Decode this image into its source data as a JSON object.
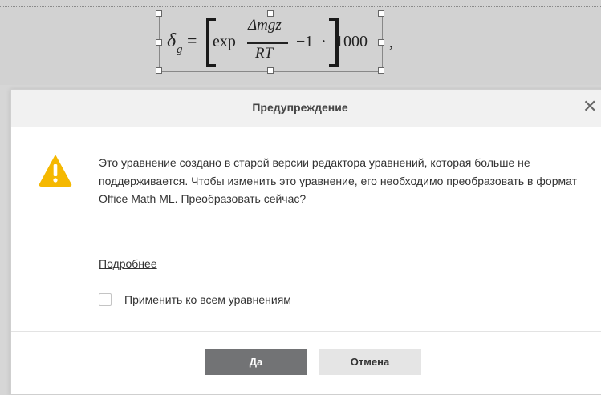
{
  "equation": {
    "delta": "δ",
    "subscript_g": "g",
    "equals": "=",
    "exp": "exp",
    "numerator": "Δmgz",
    "denominator": "RT",
    "minus_one": "−1",
    "dot": "·",
    "thousand": "1000",
    "comma": ","
  },
  "dialog": {
    "title": "Предупреждение",
    "close_glyph": "✕",
    "message": "Это уравнение создано в старой версии редактора уравнений, которая больше не поддерживается. Чтобы изменить это уравнение, его необходимо преобразовать в формат Office Math ML. Преобразовать сейчас?",
    "more_link": "Подробнее",
    "apply_all_label": "Применить ко всем уравнениям",
    "apply_all_checked": false,
    "yes_label": "Да",
    "cancel_label": "Отмена",
    "warning_icon": "warning-triangle-icon",
    "colors": {
      "warning": "#f5b800",
      "primary_button": "#727375",
      "secondary_button": "#e5e5e5"
    }
  }
}
